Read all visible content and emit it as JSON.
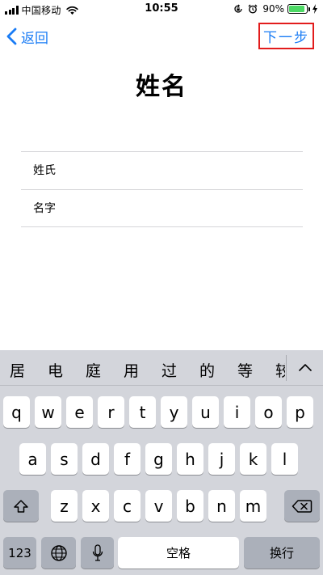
{
  "status_bar": {
    "carrier": "中国移动",
    "time": "10:55",
    "battery_percent": "90%",
    "battery_level": 0.9,
    "icons": [
      "signal-icon",
      "wifi-icon",
      "orientation-lock-icon",
      "alarm-icon",
      "battery-icon",
      "charging-icon"
    ],
    "battery_color": "#4cd964"
  },
  "nav": {
    "back_label": "返回",
    "next_label": "下一步",
    "accent_color": "#1a7cf5",
    "highlight_color": "#e21c1c"
  },
  "page": {
    "title": "姓名"
  },
  "form": {
    "last_name_placeholder": "姓氏",
    "first_name_placeholder": "名字"
  },
  "keyboard": {
    "candidates": [
      "居",
      "电",
      "庭",
      "用",
      "过",
      "的",
      "等",
      "较"
    ],
    "row1": [
      "q",
      "w",
      "e",
      "r",
      "t",
      "y",
      "u",
      "i",
      "o",
      "p"
    ],
    "row2": [
      "a",
      "s",
      "d",
      "f",
      "g",
      "h",
      "j",
      "k",
      "l"
    ],
    "row3": [
      "z",
      "x",
      "c",
      "v",
      "b",
      "n",
      "m"
    ],
    "numbers_label": "123",
    "space_label": "空格",
    "return_label": "换行"
  }
}
